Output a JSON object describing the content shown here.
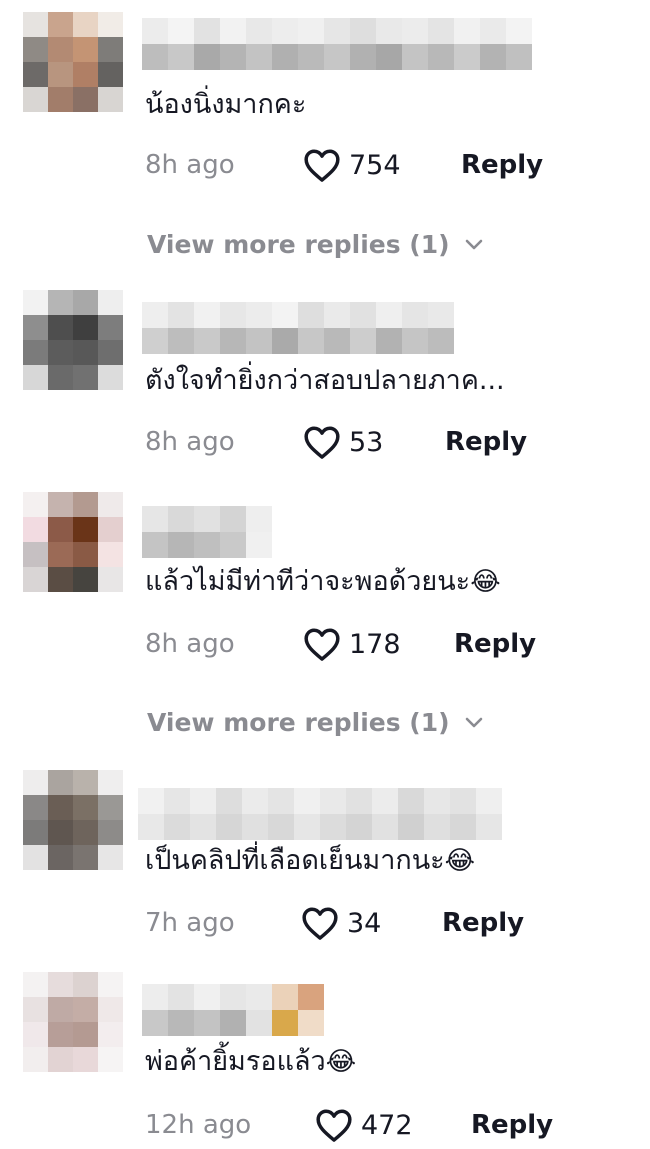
{
  "comments": [
    {
      "text": "น้องนิ่งมากคะ",
      "emoji": "",
      "time": "8h ago",
      "likes": "754",
      "reply_label": "Reply",
      "more_replies": "View more replies (1)"
    },
    {
      "text": "ตังใจทำยิ่งกว่าสอบปลายภาค...",
      "emoji": "",
      "time": "8h ago",
      "likes": "53",
      "reply_label": "Reply",
      "more_replies": ""
    },
    {
      "text": "แล้วไม่มีท่าทีว่าจะพอด้วยนะ",
      "emoji": "😂",
      "time": "8h ago",
      "likes": "178",
      "reply_label": "Reply",
      "more_replies": "View more replies (1)"
    },
    {
      "text": "เป็นคลิปที่เลือดเย็นมากนะ",
      "emoji": "😂",
      "time": "7h ago",
      "likes": "34",
      "reply_label": "Reply",
      "more_replies": ""
    },
    {
      "text": "พ่อค้ายิ้มรอแล้ว",
      "emoji": "😂",
      "time": "12h ago",
      "likes": "472",
      "reply_label": "Reply",
      "more_replies": ""
    }
  ],
  "colors": {
    "muted": "#8a8b91",
    "text": "#161823",
    "background": "#ffffff"
  },
  "icons": {
    "like": "heart-outline-icon",
    "expand": "chevron-down-icon",
    "emoji": "face-with-tears-of-joy"
  }
}
